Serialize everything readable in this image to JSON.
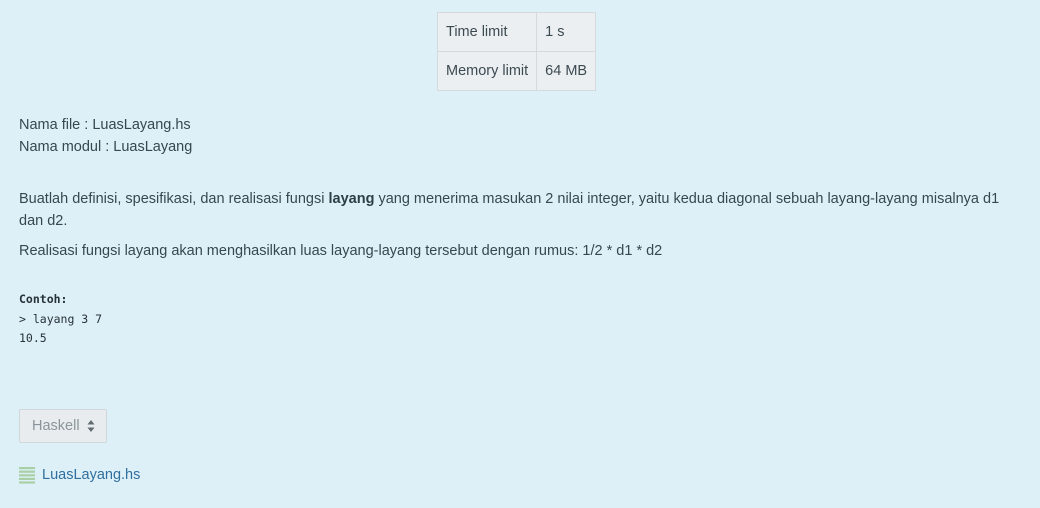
{
  "limits": {
    "time_label": "Time limit",
    "time_value": "1 s",
    "memory_label": "Memory limit",
    "memory_value": "64 MB"
  },
  "file_info": {
    "file_name": "Nama file : LuasLayang.hs",
    "module_name": "Nama modul : LuasLayang"
  },
  "description": {
    "p1_before": "Buatlah definisi, spesifikasi, dan realisasi fungsi ",
    "p1_bold": "layang",
    "p1_after": " yang menerima masukan 2 nilai integer, yaitu kedua diagonal sebuah layang-layang misalnya d1 dan d2.",
    "p2": "Realisasi fungsi layang akan menghasilkan luas layang-layang tersebut dengan rumus: 1/2 * d1 * d2"
  },
  "example": {
    "heading": "Contoh:",
    "line1": "> layang 3 7",
    "line2": "10.5"
  },
  "language_select": {
    "selected": "Haskell"
  },
  "attachment": {
    "label": "LuasLayang.hs",
    "icon": "text-file-icon"
  }
}
